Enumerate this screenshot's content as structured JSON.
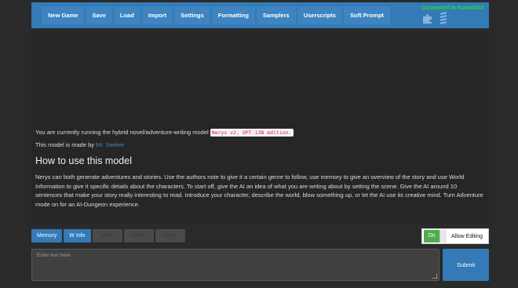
{
  "menu": {
    "items": [
      "New Game",
      "Save",
      "Load",
      "Import",
      "Settings",
      "Formatting",
      "Samplers",
      "Userscripts",
      "Soft Prompt"
    ],
    "status": "Connected to KoboldAI!",
    "icons": [
      "puzzle-icon",
      "menu-icon"
    ]
  },
  "story": {
    "intro": "You are currently running the hybrid novel/adventure-writing model",
    "model_code": "Nerys v2, OPT-13B edition.",
    "made_by_prefix": "This model is made by",
    "author": "Mr. Seeker",
    "heading": "How to use this model",
    "description": "Nerys can both generate adventures and stories. Use the authors note to give it a certain genre to follow, use memory to give an overview of the story and use World Information to give it specific details about the characters. To start off, give the AI an idea of what you are writing about by setting the scene. Give the AI around 10 sentences that make your story really interesting to read. Introduce your character, describe the world, blow something up, or let the AI use its creative mind. Turn Adventure mode on for an AI-Dungeon experience."
  },
  "controls": {
    "memory": "Memory",
    "winfo": "W Info",
    "back": "Back",
    "redo": "Redo",
    "retry": "Retry",
    "toggle_on": "On",
    "allow_editing": "Allow Editing"
  },
  "input": {
    "placeholder": "Enter text here",
    "submit": "Submit"
  },
  "colors": {
    "accent": "#337ab7",
    "status_green": "#2bdc2b",
    "toggle_green": "#4cae4c",
    "author_link": "#3c83c6"
  }
}
